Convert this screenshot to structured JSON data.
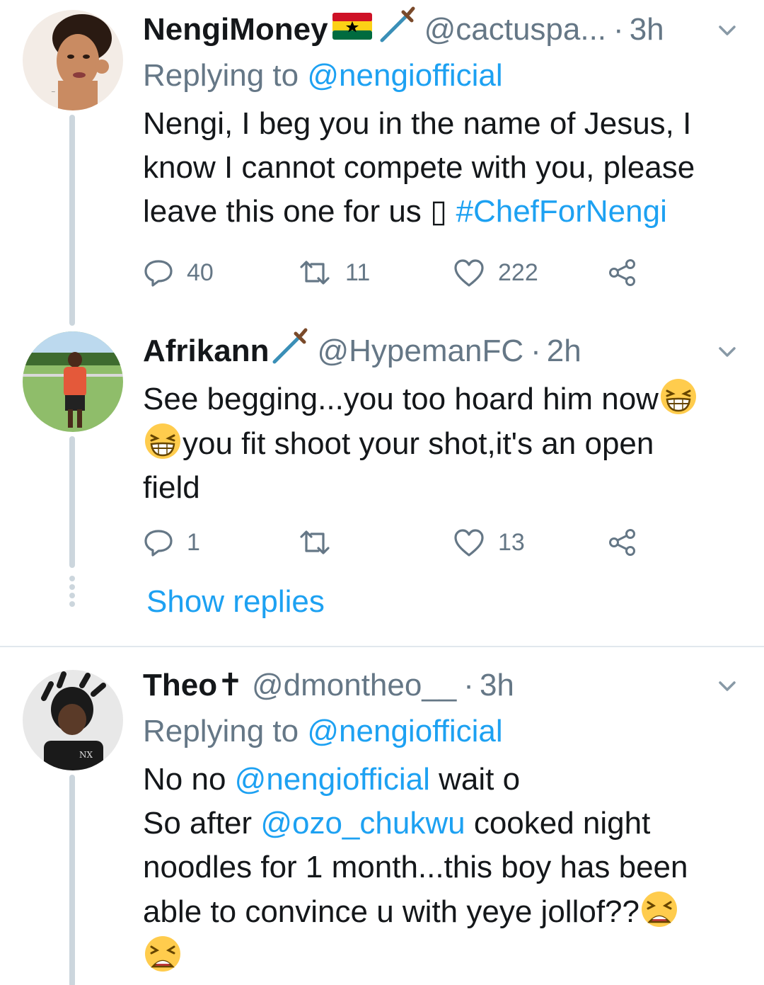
{
  "tweets": [
    {
      "name": "NengiMoney",
      "name_icons": [
        "ghana-flag-icon",
        "dagger-icon"
      ],
      "handle": "@cactuspa...",
      "time": "3h",
      "replying_prefix": "Replying to",
      "replying_to": "@nengiofficial",
      "text_lines": [
        "Nengi, I beg you in the name of Jesus, I",
        "know I cannot compete with you, please",
        "leave this one for us"
      ],
      "placeholder_glyph": "▯",
      "hashtag": "#ChefForNengi",
      "replies": "40",
      "retweets": "11",
      "likes": "222"
    },
    {
      "name": "Afrikann",
      "name_icons": [
        "dagger-icon"
      ],
      "handle": "@HypemanFC",
      "time": "2h",
      "text_lines": [
        "See begging...you too hoard him now",
        "you fit shoot your shot,it's an open",
        "field"
      ],
      "emojis": [
        "grinning-squint-icon",
        "grinning-squint-icon"
      ],
      "replies": "1",
      "retweets": "",
      "likes": "13"
    },
    {
      "name": "Theo✝",
      "handle": "@dmontheo__",
      "time": "3h",
      "replying_prefix": "Replying to",
      "replying_to": "@nengiofficial",
      "line1_prefix": "No no",
      "line1_mention": "@nengiofficial",
      "line1_suffix": "wait o",
      "line2_prefix": "So after",
      "line2_mention": "@ozo_chukwu",
      "line2_suffix": "cooked night",
      "line3": "noodles for 1 month...this boy has been",
      "line4": "able to convince u with yeye jollof??",
      "emojis": [
        "tired-face-icon",
        "tired-face-icon"
      ]
    }
  ],
  "show_replies_label": "Show replies",
  "colors": {
    "link": "#1da1f2",
    "secondary": "#657786",
    "thread_line": "#ccd6dd",
    "divider": "#e1e8ed"
  }
}
